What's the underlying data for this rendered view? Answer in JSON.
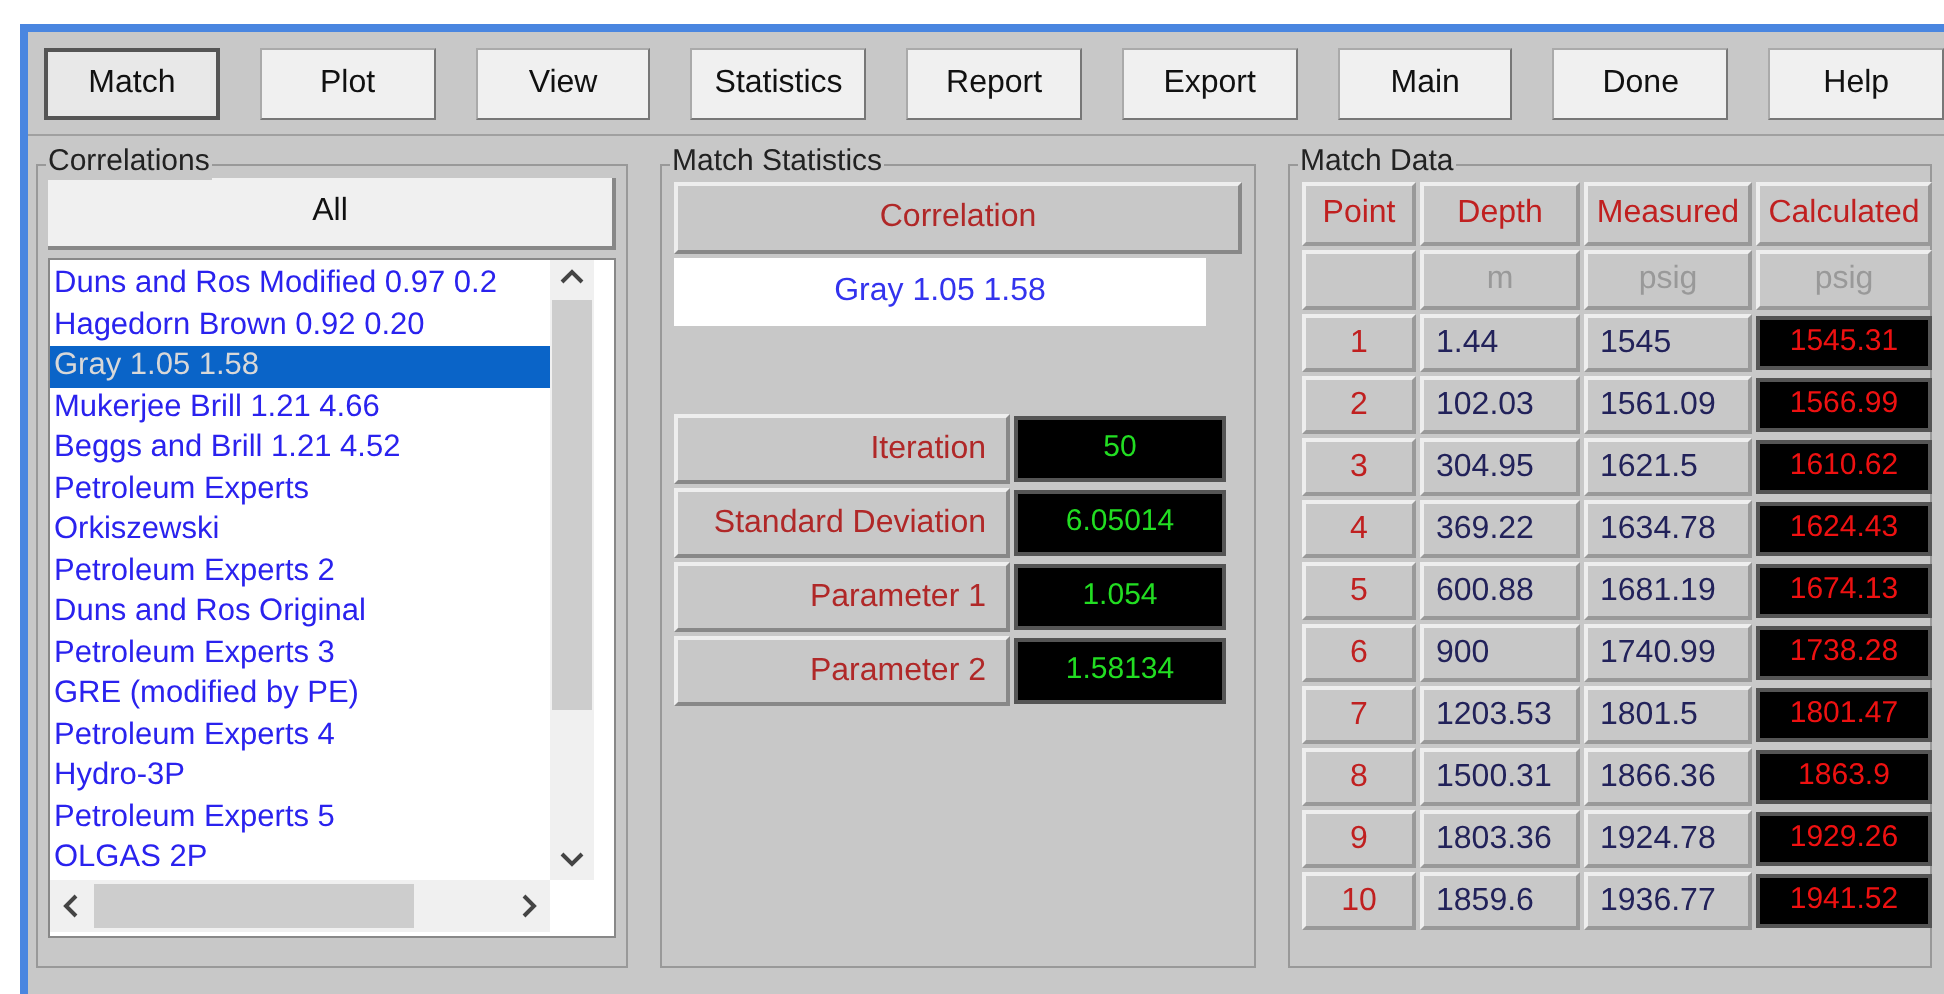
{
  "toolbar": [
    {
      "label": "Match",
      "pressed": true
    },
    {
      "label": "Plot",
      "pressed": false
    },
    {
      "label": "View",
      "pressed": false
    },
    {
      "label": "Statistics",
      "pressed": false
    },
    {
      "label": "Report",
      "pressed": false
    },
    {
      "label": "Export",
      "pressed": false
    },
    {
      "label": "Main",
      "pressed": false
    },
    {
      "label": "Done",
      "pressed": false
    },
    {
      "label": "Help",
      "pressed": false
    }
  ],
  "correlations": {
    "title": "Correlations",
    "all_button": "All",
    "items": [
      {
        "label": "Duns and Ros Modified 0.97 0.2",
        "selected": false
      },
      {
        "label": "Hagedorn Brown 0.92 0.20",
        "selected": false
      },
      {
        "label": "Gray 1.05 1.58",
        "selected": true
      },
      {
        "label": "Mukerjee Brill 1.21 4.66",
        "selected": false
      },
      {
        "label": "Beggs and Brill 1.21 4.52",
        "selected": false
      },
      {
        "label": "Petroleum Experts",
        "selected": false
      },
      {
        "label": "Orkiszewski",
        "selected": false
      },
      {
        "label": "Petroleum Experts 2",
        "selected": false
      },
      {
        "label": "Duns and Ros Original",
        "selected": false
      },
      {
        "label": "Petroleum Experts 3",
        "selected": false
      },
      {
        "label": "GRE (modified by PE)",
        "selected": false
      },
      {
        "label": "Petroleum Experts 4",
        "selected": false
      },
      {
        "label": "Hydro-3P",
        "selected": false
      },
      {
        "label": "Petroleum Experts 5",
        "selected": false
      },
      {
        "label": "OLGAS 2P",
        "selected": false
      }
    ]
  },
  "match_statistics": {
    "title": "Match Statistics",
    "correlation_label": "Correlation",
    "correlation_value": "Gray 1.05 1.58",
    "stats": [
      {
        "label": "Iteration",
        "value": "50"
      },
      {
        "label": "Standard Deviation",
        "value": "6.05014"
      },
      {
        "label": "Parameter 1",
        "value": "1.054"
      },
      {
        "label": "Parameter 2",
        "value": "1.58134"
      }
    ]
  },
  "match_data": {
    "title": "Match Data",
    "columns": [
      {
        "name": "Point"
      },
      {
        "name": "Depth",
        "unit": "m"
      },
      {
        "name": "Measured",
        "unit": "psig"
      },
      {
        "name": "Calculated",
        "unit": "psig"
      }
    ],
    "rows": [
      [
        "1",
        "1.44",
        "1545",
        "1545.31"
      ],
      [
        "2",
        "102.03",
        "1561.09",
        "1566.99"
      ],
      [
        "3",
        "304.95",
        "1621.5",
        "1610.62"
      ],
      [
        "4",
        "369.22",
        "1634.78",
        "1624.43"
      ],
      [
        "5",
        "600.88",
        "1681.19",
        "1674.13"
      ],
      [
        "6",
        "900",
        "1740.99",
        "1738.28"
      ],
      [
        "7",
        "1203.53",
        "1801.5",
        "1801.47"
      ],
      [
        "8",
        "1500.31",
        "1866.36",
        "1863.9"
      ],
      [
        "9",
        "1803.36",
        "1924.78",
        "1929.26"
      ],
      [
        "10",
        "1859.6",
        "1936.77",
        "1941.52"
      ]
    ]
  }
}
